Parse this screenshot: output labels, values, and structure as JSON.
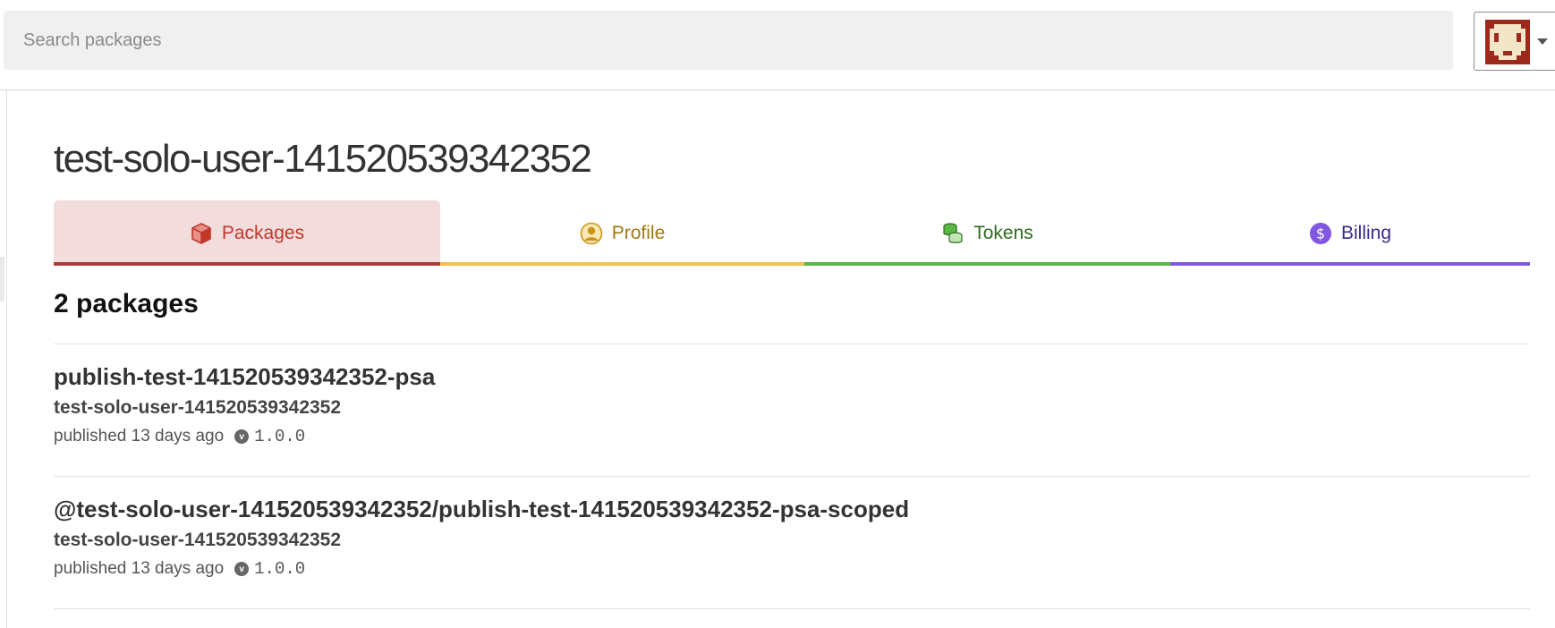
{
  "search": {
    "placeholder": "Search packages",
    "value": ""
  },
  "user_menu": {
    "avatar_icon": "pixel-avatar-icon"
  },
  "page_title": "test-solo-user-141520539342352",
  "tabs": [
    {
      "label": "Packages",
      "icon": "package-cube-icon",
      "color": "#c0392b",
      "underline": "#b33a3a",
      "active": true
    },
    {
      "label": "Profile",
      "icon": "user-circle-icon",
      "color": "#a07b12",
      "underline": "#f2c14e",
      "active": false
    },
    {
      "label": "Tokens",
      "icon": "coins-stack-icon",
      "color": "#2e6b1f",
      "underline": "#5ab647",
      "active": false
    },
    {
      "label": "Billing",
      "icon": "dollar-circle-icon",
      "color": "#3b2a8a",
      "underline": "#8057e0",
      "active": false
    }
  ],
  "package_count": "2 packages",
  "packages": [
    {
      "name": "publish-test-141520539342352-psa",
      "publisher": "test-solo-user-141520539342352",
      "published": "published 13 days ago",
      "version": "1.0.0"
    },
    {
      "name": "@test-solo-user-141520539342352/publish-test-141520539342352-psa-scoped",
      "publisher": "test-solo-user-141520539342352",
      "published": "published 13 days ago",
      "version": "1.0.0"
    }
  ]
}
